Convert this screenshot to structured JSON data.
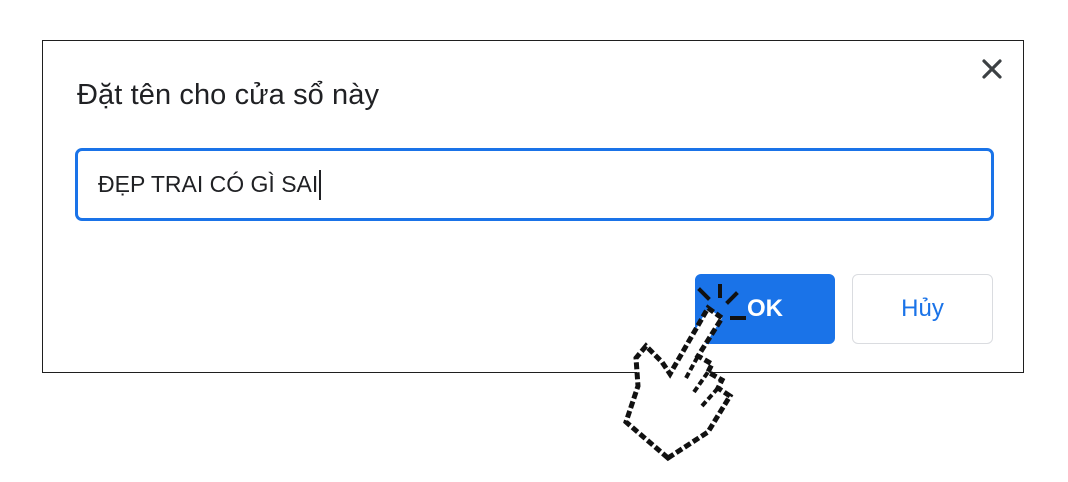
{
  "dialog": {
    "title": "Đặt tên cho cửa sổ này",
    "close_icon": "close-icon",
    "input": {
      "value": "ĐẸP TRAI CÓ GÌ SAI",
      "placeholder": ""
    },
    "ok_label": "OK",
    "cancel_label": "Hủy"
  },
  "cursor": {
    "icon": "hand-pointer-icon"
  },
  "colors": {
    "accent": "#1a73e8",
    "text": "#202124",
    "border": "#dadce0"
  }
}
